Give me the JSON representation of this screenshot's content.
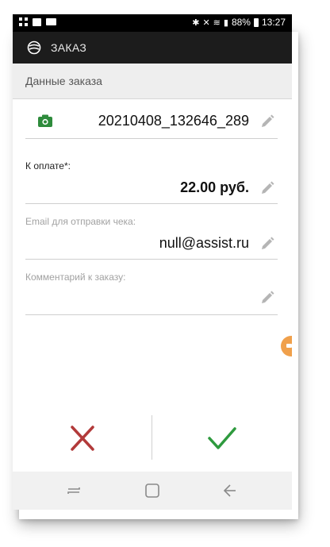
{
  "status_bar": {
    "battery": "88%",
    "time": "13:27",
    "icons": [
      "grid-icon",
      "image-icon",
      "video-icon",
      "bluetooth-icon",
      "mute-icon",
      "wifi-icon",
      "signal-icon",
      "battery-icon"
    ]
  },
  "app_bar": {
    "title": "ЗАКАЗ",
    "logo_icon": "assist-logo-icon"
  },
  "section": {
    "title": "Данные заказа"
  },
  "order": {
    "id": "20210408_132646_289",
    "camera_icon": "camera-icon"
  },
  "payment": {
    "label": "К оплате*:",
    "value": "22.00 руб."
  },
  "email": {
    "label": "Email для отправки чека:",
    "value": "null@assist.ru"
  },
  "comment": {
    "label": "Комментарий к заказу:",
    "value": ""
  },
  "actions": {
    "cancel_icon": "close-icon",
    "confirm_icon": "check-icon"
  },
  "nav": {
    "icons": [
      "recent-apps-icon",
      "home-icon",
      "back-icon"
    ]
  },
  "colors": {
    "app_bar": "#1c1c1c",
    "camera": "#2e8b3c",
    "cancel": "#b23a3a",
    "confirm": "#2e9a3e",
    "side_tab": "#f0a04b"
  }
}
